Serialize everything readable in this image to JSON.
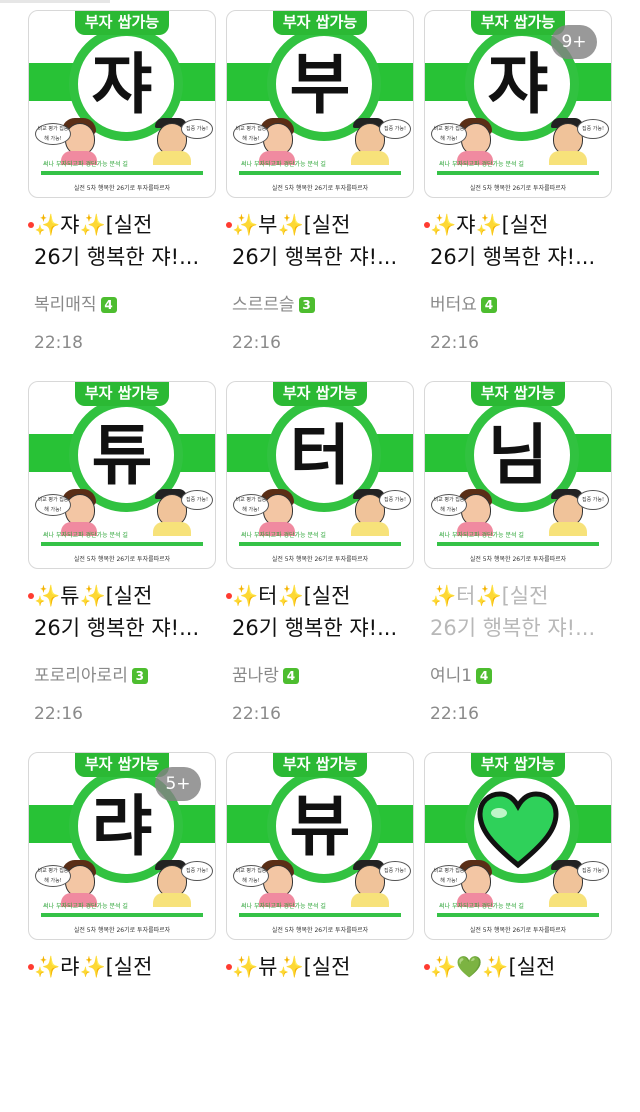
{
  "thumbnail_brand": "부자 쌉가능",
  "thumbnail_stations": "써나 부자되고파 경단가능 분석 길",
  "thumbnail_footer": "실전 5차 행복한 26기로 투자를따르자",
  "bubble_left": "비교 평가 집중해 가능!",
  "bubble_right": "집중 가능!",
  "colors": {
    "brand_green": "#2bb934",
    "unread_dot": "#ff3b30",
    "level_badge": "#4dbd2f",
    "meta_gray": "#8a8a8a"
  },
  "posts": [
    {
      "glyph": "쟈",
      "title_line1": "✨쟈✨[실전",
      "title_line2": "26기 행복한 쟈!...",
      "author": "복리매직",
      "level": "4",
      "time": "22:18",
      "count_badge": "",
      "unread": true,
      "read_style": false
    },
    {
      "glyph": "부",
      "title_line1": "✨부✨[실전",
      "title_line2": "26기 행복한 쟈!...",
      "author": "스르르슬",
      "level": "3",
      "time": "22:16",
      "count_badge": "",
      "unread": true,
      "read_style": false
    },
    {
      "glyph": "쟈",
      "title_line1": "✨쟈✨[실전",
      "title_line2": "26기 행복한 쟈!...",
      "author": "버터요",
      "level": "4",
      "time": "22:16",
      "count_badge": "9+",
      "unread": true,
      "read_style": false
    },
    {
      "glyph": "튜",
      "title_line1": "✨튜✨[실전",
      "title_line2": "26기 행복한 쟈!...",
      "author": "포로리아로리",
      "level": "3",
      "time": "22:16",
      "count_badge": "",
      "unread": true,
      "read_style": false
    },
    {
      "glyph": "터",
      "title_line1": "✨터✨[실전",
      "title_line2": "26기 행복한 쟈!...",
      "author": "꿈나랑",
      "level": "4",
      "time": "22:16",
      "count_badge": "",
      "unread": true,
      "read_style": false
    },
    {
      "glyph": "님",
      "title_line1": "✨터✨[실전",
      "title_line2": "26기 행복한 쟈!...",
      "author": "여니1",
      "level": "4",
      "time": "22:16",
      "count_badge": "",
      "unread": false,
      "read_style": true
    },
    {
      "glyph": "랴",
      "title_line1": "✨랴✨[실전",
      "title_line2": "",
      "author": "",
      "level": "",
      "time": "",
      "count_badge": "5+",
      "unread": true,
      "read_style": false
    },
    {
      "glyph": "뷰",
      "title_line1": "✨뷰✨[실전",
      "title_line2": "",
      "author": "",
      "level": "",
      "time": "",
      "count_badge": "",
      "unread": true,
      "read_style": false
    },
    {
      "glyph": "",
      "heart_icon": "green-heart-icon",
      "title_line1": "✨💚✨[실전",
      "title_line2": "",
      "author": "",
      "level": "",
      "time": "",
      "count_badge": "",
      "unread": true,
      "read_style": false
    }
  ]
}
